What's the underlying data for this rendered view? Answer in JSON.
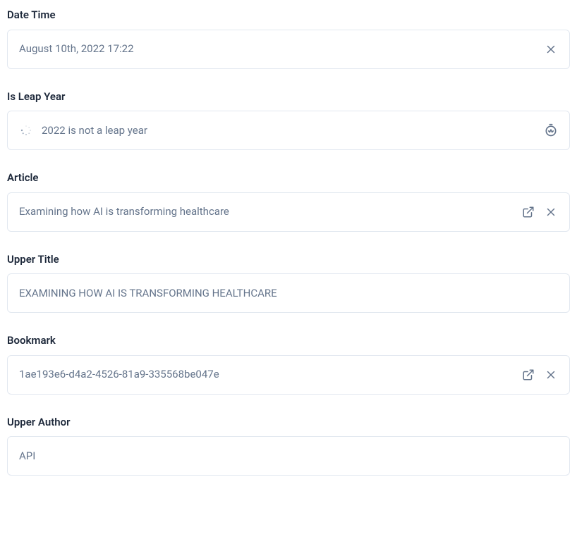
{
  "fields": {
    "dateTime": {
      "label": "Date Time",
      "value": "August 10th, 2022 17:22"
    },
    "isLeapYear": {
      "label": "Is Leap Year",
      "value": "2022 is not a leap year"
    },
    "article": {
      "label": "Article",
      "value": "Examining how AI is transforming healthcare"
    },
    "upperTitle": {
      "label": "Upper Title",
      "value": "EXAMINING HOW AI IS TRANSFORMING HEALTHCARE"
    },
    "bookmark": {
      "label": "Bookmark",
      "value": "1ae193e6-d4a2-4526-81a9-335568be047e"
    },
    "upperAuthor": {
      "label": "Upper Author",
      "value": "API"
    }
  }
}
